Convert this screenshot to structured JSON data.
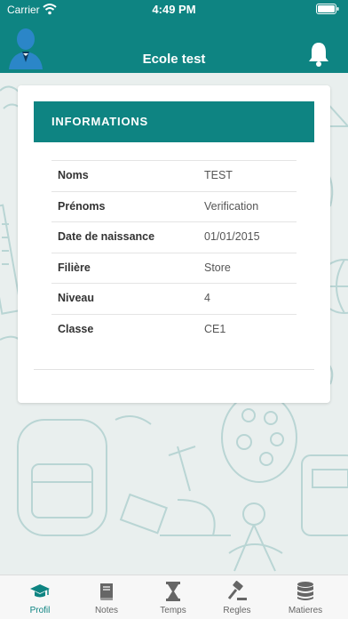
{
  "status_bar": {
    "carrier": "Carrier",
    "time": "4:49 PM",
    "wifi_icon": "wifi-icon",
    "battery_icon": "battery-icon"
  },
  "header": {
    "title": "Ecole test",
    "avatar_icon": "user-avatar-icon",
    "bell_icon": "bell-icon"
  },
  "card": {
    "title": "INFORMATIONS",
    "rows": [
      {
        "label": "Noms",
        "value": "TEST"
      },
      {
        "label": "Prénoms",
        "value": "Verification"
      },
      {
        "label": "Date de naissance",
        "value": "01/01/2015"
      },
      {
        "label": "Filière",
        "value": "Store"
      },
      {
        "label": "Niveau",
        "value": "4"
      },
      {
        "label": "Classe",
        "value": "CE1"
      }
    ]
  },
  "tabs": [
    {
      "label": "Profil",
      "icon": "graduation-cap-icon",
      "active": true
    },
    {
      "label": "Notes",
      "icon": "book-icon",
      "active": false
    },
    {
      "label": "Temps",
      "icon": "hourglass-icon",
      "active": false
    },
    {
      "label": "Regles",
      "icon": "gavel-icon",
      "active": false
    },
    {
      "label": "Matieres",
      "icon": "database-icon",
      "active": false
    }
  ],
  "colors": {
    "primary": "#0e8482",
    "background": "#e9efee",
    "doodle": "#a9cccb",
    "tab_inactive": "#666666"
  }
}
